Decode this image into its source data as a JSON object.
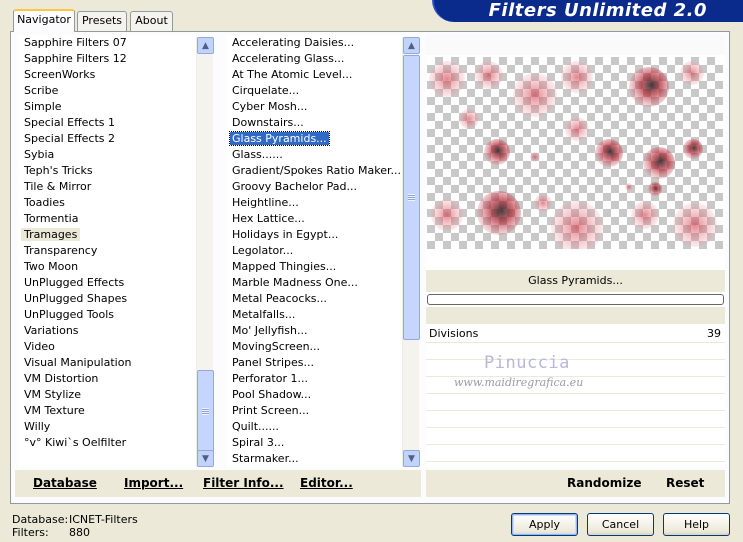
{
  "banner": {
    "title": "Filters Unlimited 2.0"
  },
  "tabs": [
    {
      "label": "Navigator",
      "active": true
    },
    {
      "label": "Presets",
      "active": false
    },
    {
      "label": "About",
      "active": false
    }
  ],
  "categories": {
    "items": [
      "Sapphire Filters 07",
      "Sapphire Filters 12",
      "ScreenWorks",
      "Scribe",
      "Simple",
      "Special Effects 1",
      "Special Effects 2",
      "Sybia",
      "Teph's Tricks",
      "Tile & Mirror",
      "Toadies",
      "Tormentia",
      "Tramages",
      "Transparency",
      "Two Moon",
      "UnPlugged Effects",
      "UnPlugged Shapes",
      "UnPlugged Tools",
      "Variations",
      "Video",
      "Visual Manipulation",
      "VM Distortion",
      "VM Stylize",
      "VM Texture",
      "Willy",
      "°v° Kiwi`s Oelfilter"
    ],
    "selected": "Tramages"
  },
  "filters": {
    "items": [
      "Accelerating Daisies...",
      "Accelerating Glass...",
      "At The Atomic Level...",
      "Cirquelate...",
      "Cyber Mosh...",
      "Downstairs...",
      "Glass Pyramids...",
      "Glass......",
      "Gradient/Spokes Ratio Maker...",
      "Groovy Bachelor Pad...",
      "Heightline...",
      "Hex Lattice...",
      "Holidays in Egypt...",
      "Legolator...",
      "Mapped Thingies...",
      "Marble Madness One...",
      "Metal Peacocks...",
      "Metalfalls...",
      "Mo' Jellyfish...",
      "MovingScreen...",
      "Panel Stripes...",
      "Perforator 1...",
      "Pool Shadow...",
      "Print Screen...",
      "Quilt......",
      "Spiral 3...",
      "Starmaker..."
    ],
    "selected": "Glass Pyramids..."
  },
  "left_actions": {
    "database": "Database",
    "import": "Import...",
    "filter_info": "Filter Info...",
    "editor": "Editor..."
  },
  "right_actions": {
    "randomize": "Randomize",
    "reset": "Reset"
  },
  "preview": {
    "filter_name": "Glass Pyramids...",
    "progress_fraction": 0.0
  },
  "params": [
    {
      "label": "Divisions",
      "value": "39"
    }
  ],
  "watermark": {
    "name": "Pinuccia",
    "url": "www.maidiregrafica.eu"
  },
  "status": {
    "database_label": "Database:",
    "database_value": "ICNET-Filters",
    "filters_label": "Filters:",
    "filters_value": "880"
  },
  "buttons": {
    "apply": "Apply",
    "cancel": "Cancel",
    "help": "Help"
  },
  "colors": {
    "banner": "#0a2a8c",
    "selection": "#316ac5",
    "tab_highlight": "#ffc83c"
  }
}
